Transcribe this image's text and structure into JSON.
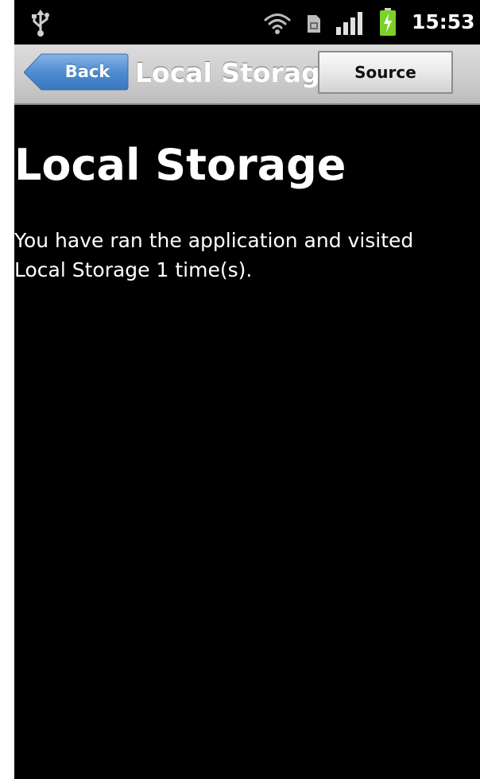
{
  "status_bar": {
    "time": "15:53",
    "icons": [
      "usb-icon",
      "wifi-icon",
      "sim-card-icon",
      "signal-strength-icon",
      "battery-charging-icon"
    ]
  },
  "title_bar": {
    "back_label": "Back",
    "title": "Local Storage",
    "source_label": "Source"
  },
  "content": {
    "heading": "Local Storage",
    "message": "You have ran the application and visited Local Storage 1 time(s)."
  },
  "colors": {
    "background": "#000000",
    "text": "#ffffff",
    "back_button": "#4a8ad0",
    "battery": "#7bd12a"
  }
}
